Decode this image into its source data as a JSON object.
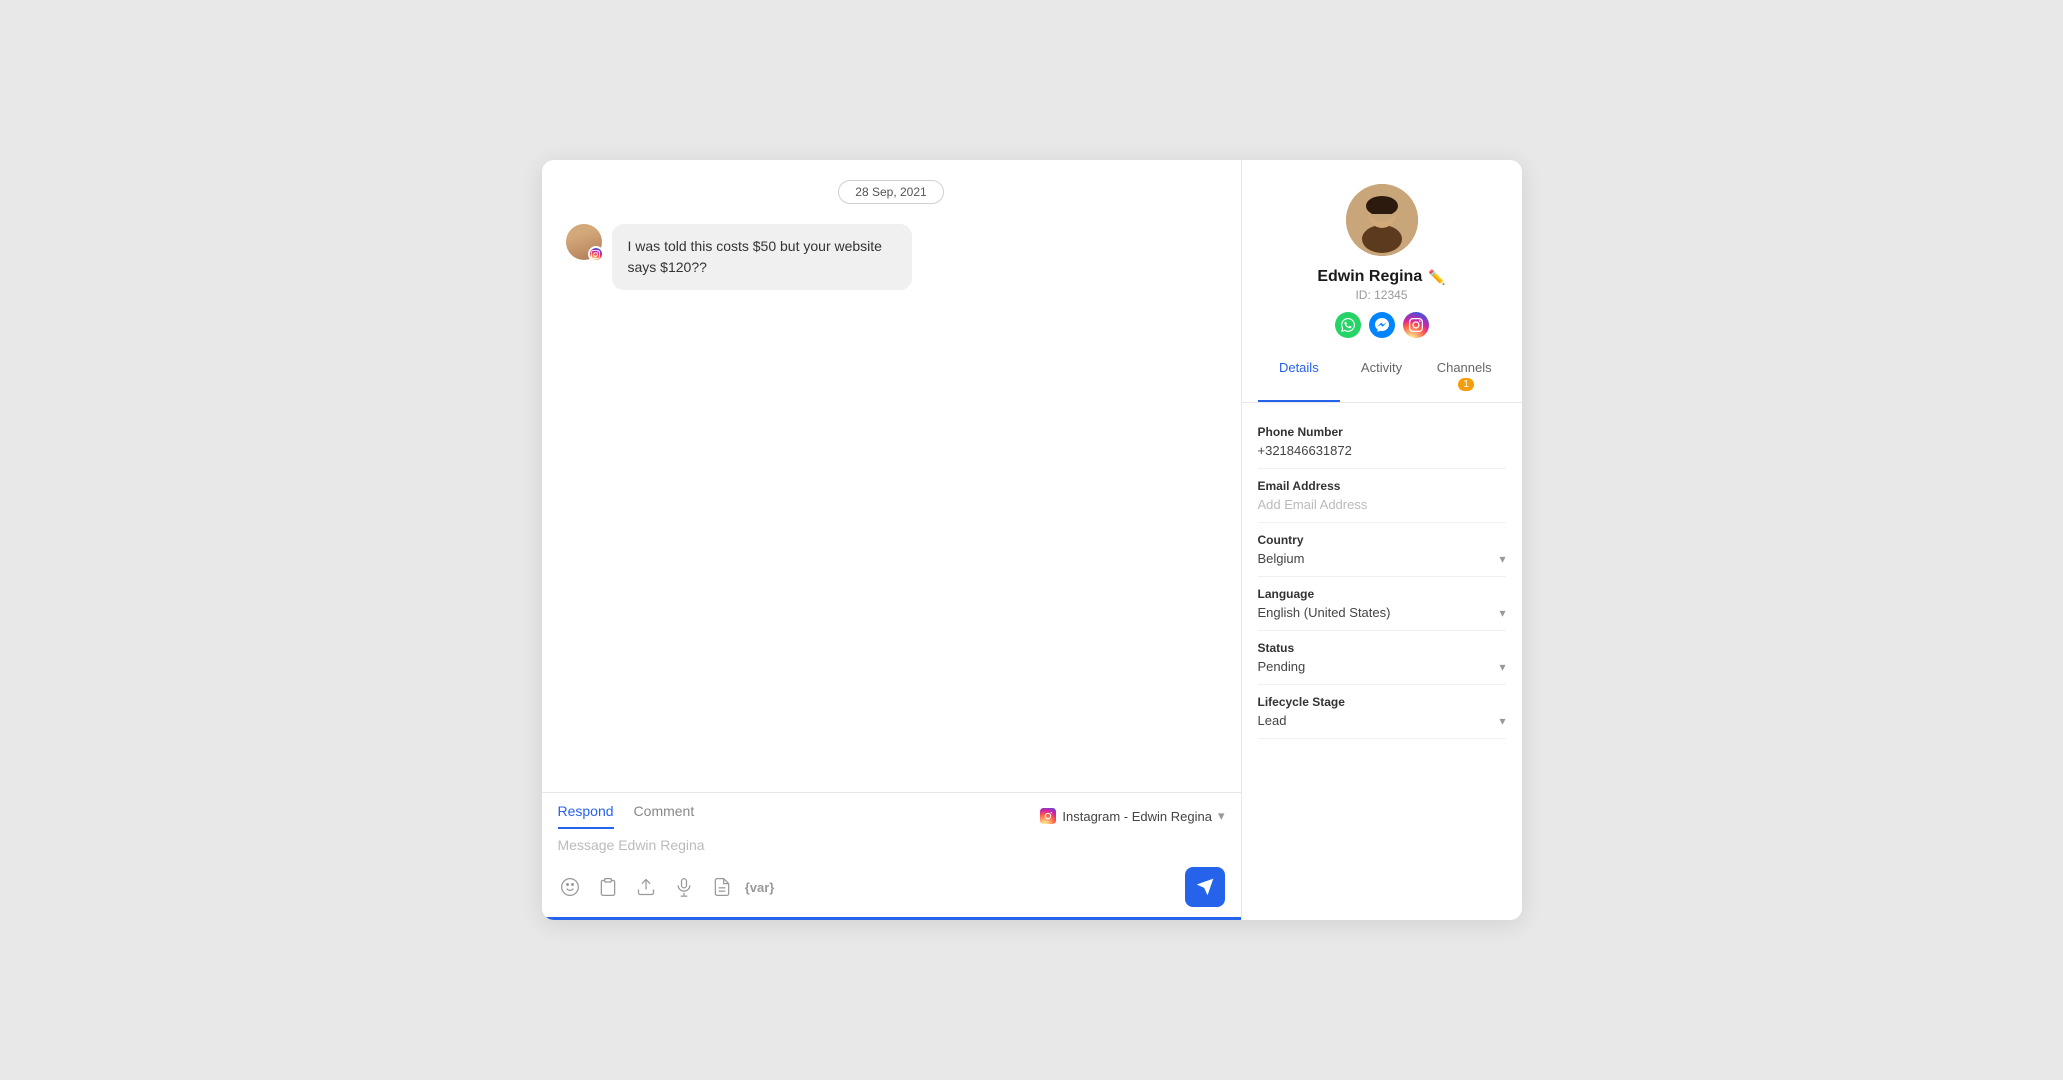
{
  "chat": {
    "date_divider": "28 Sep, 2021",
    "message": "I was told this costs $50 but your website says $120??",
    "respond_tab": "Respond",
    "comment_tab": "Comment",
    "channel_label": "Instagram - Edwin Regina",
    "message_placeholder": "Message Edwin Regina",
    "tabs": [
      "Respond",
      "Comment"
    ]
  },
  "toolbar": {
    "icons": [
      "emoji",
      "clipboard",
      "upload",
      "microphone",
      "document",
      "variable"
    ],
    "send_label": "Send"
  },
  "contact": {
    "name": "Edwin Regina",
    "id_label": "ID: 12345",
    "tabs": [
      "Details",
      "Activity",
      "Channels"
    ],
    "channels_badge": "1",
    "details": {
      "phone_label": "Phone Number",
      "phone_value": "+321846631872",
      "email_label": "Email Address",
      "email_placeholder": "Add Email Address",
      "country_label": "Country",
      "country_value": "Belgium",
      "language_label": "Language",
      "language_value": "English (United States)",
      "status_label": "Status",
      "status_value": "Pending",
      "lifecycle_label": "Lifecycle Stage",
      "lifecycle_value": "Lead"
    }
  }
}
